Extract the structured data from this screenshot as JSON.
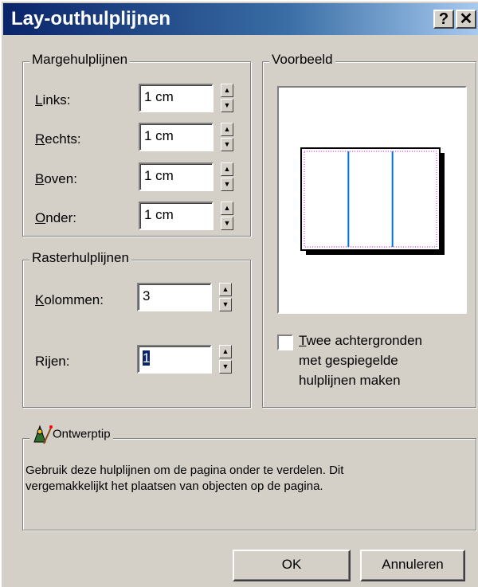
{
  "window": {
    "title": "Lay-outhulplijnen",
    "help_label": "?",
    "close_label": "✕"
  },
  "margins": {
    "legend": "Margehulplijnen",
    "fields": [
      {
        "key": "L",
        "rest": "inks:",
        "value": "1 cm"
      },
      {
        "key": "R",
        "rest": "echts:",
        "value": "1 cm"
      },
      {
        "key": "B",
        "rest": "oven:",
        "value": "1 cm"
      },
      {
        "key": "O",
        "rest": "nder:",
        "value": "1 cm"
      }
    ]
  },
  "grid": {
    "legend": "Rasterhulplijnen",
    "columns": {
      "key": "K",
      "rest": "olommen:",
      "value": "3"
    },
    "rows": {
      "pre": "Ri",
      "key": "j",
      "rest": "en:",
      "value": "1"
    }
  },
  "preview": {
    "legend": "Voorbeeld",
    "columns": 3,
    "guide_color": "#0078d7",
    "margin_color": "#ff00ff"
  },
  "mirror": {
    "key": "T",
    "line1_rest": "wee achtergronden",
    "line2": "met gespiegelde",
    "line3": "hulplijnen maken",
    "checked": false
  },
  "tip": {
    "legend": "Ontwerptip",
    "icon": "wizard-icon",
    "line1": "Gebruik deze hulplijnen om de pagina onder te verdelen. Dit",
    "line2": "vergemakkelijkt het plaatsen van objecten op de pagina."
  },
  "buttons": {
    "ok": "OK",
    "cancel": "Annuleren"
  }
}
